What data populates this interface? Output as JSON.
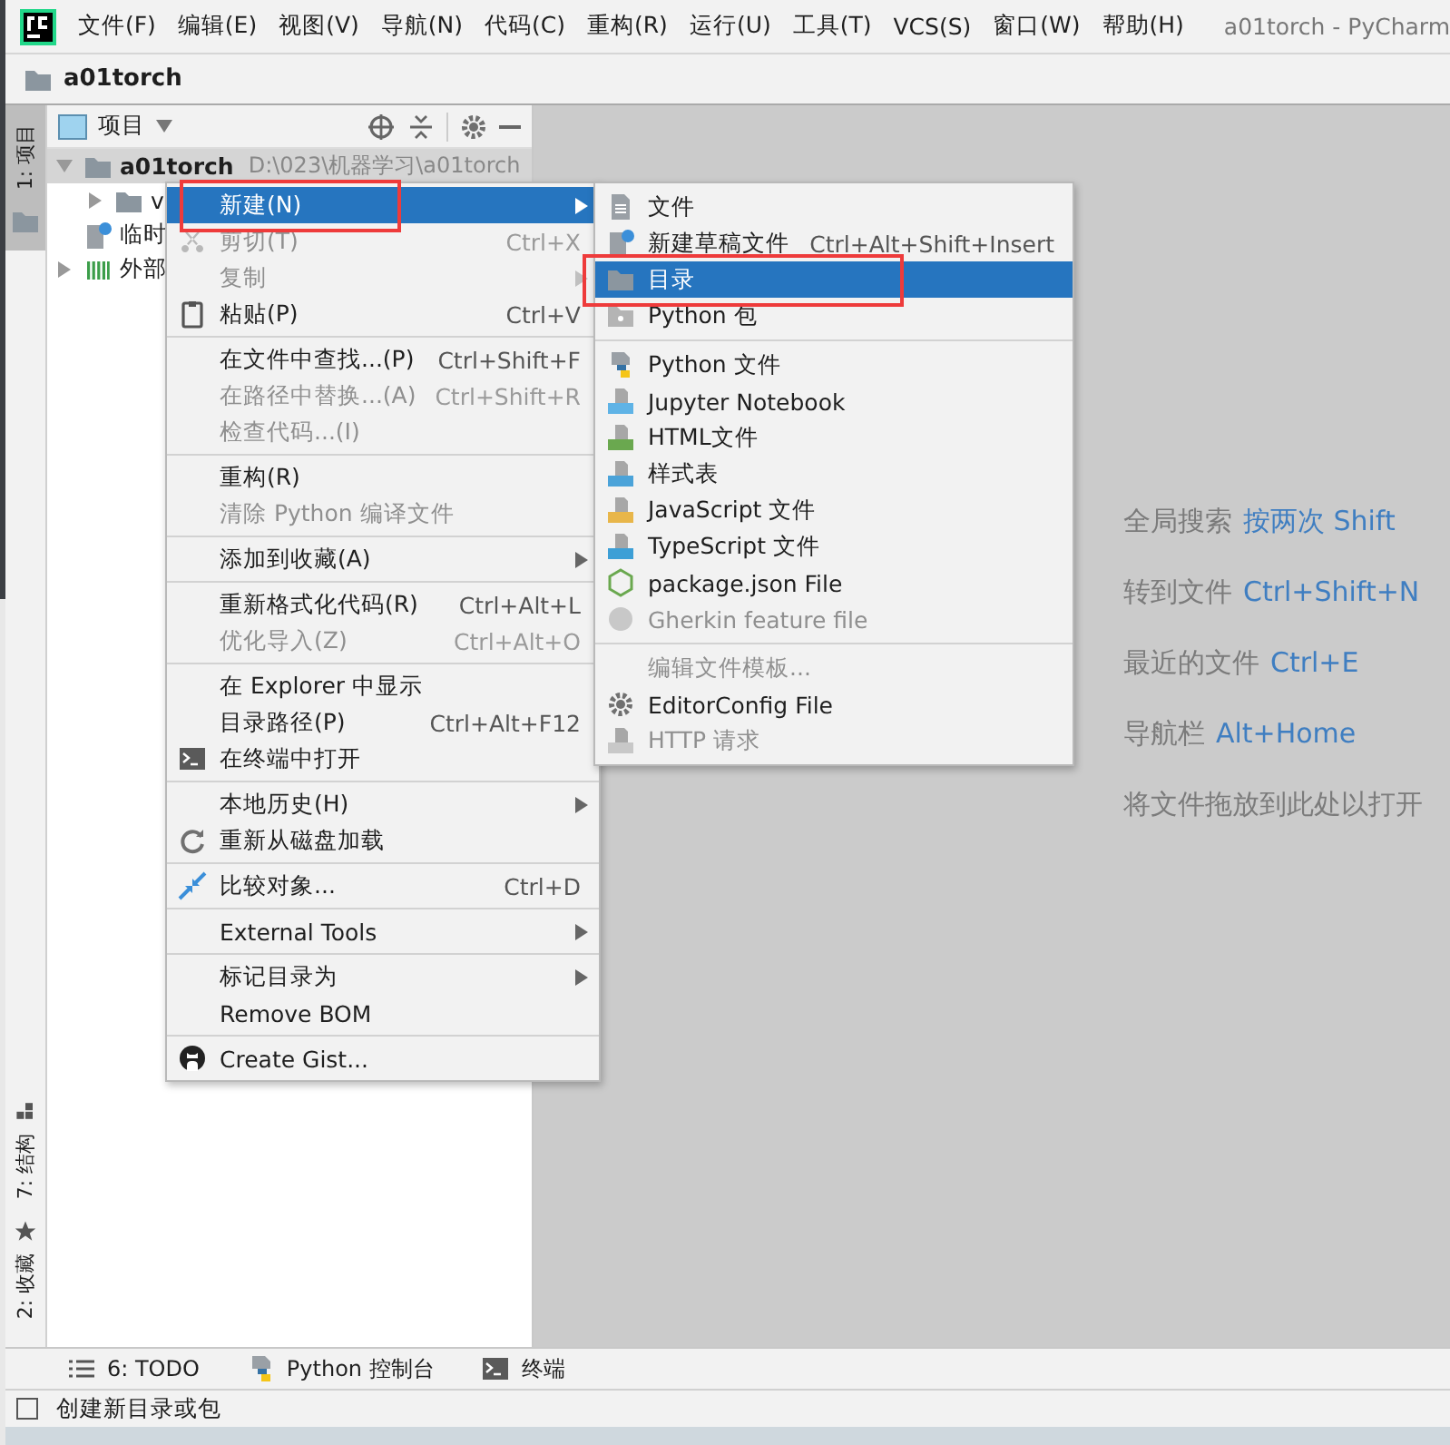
{
  "window": {
    "title": "a01torch - PyCharm"
  },
  "menu_bar": [
    "文件(F)",
    "编辑(E)",
    "视图(V)",
    "导航(N)",
    "代码(C)",
    "重构(R)",
    "运行(U)",
    "工具(T)",
    "VCS(S)",
    "窗口(W)",
    "帮助(H)"
  ],
  "nav_bar": {
    "crumb": "a01torch"
  },
  "tool_strip": [
    {
      "label": "1: 项目",
      "selected": true,
      "kind": "folder"
    },
    {
      "label": "7: 结构",
      "selected": false,
      "kind": "structure"
    },
    {
      "label": "2: 收藏",
      "selected": false,
      "kind": "star"
    }
  ],
  "project_panel": {
    "title": "项目",
    "tree": [
      {
        "label": "a01torch",
        "path": "D:\\023\\机器学习\\a01torch",
        "kind": "folder",
        "selected": true,
        "expanded": true,
        "children": [
          {
            "label": "v",
            "kind": "folder",
            "selected": false,
            "expanded": false
          }
        ]
      },
      {
        "label": "临时",
        "kind": "scratch",
        "selected": false
      },
      {
        "label": "外部",
        "kind": "library",
        "selected": false,
        "expanded": false
      }
    ]
  },
  "editor_hints": [
    {
      "label": "全局搜索",
      "shortcut": "按两次 Shift"
    },
    {
      "label": "转到文件",
      "shortcut": "Ctrl+Shift+N"
    },
    {
      "label": "最近的文件",
      "shortcut": "Ctrl+E"
    },
    {
      "label": "导航栏",
      "shortcut": "Alt+Home"
    },
    {
      "label": "将文件拖放到此处以打开"
    }
  ],
  "context_menu": {
    "groups": [
      {
        "items": [
          {
            "label": "新建(N)",
            "selected": true,
            "disabled": false,
            "submenu": true,
            "boxed": true
          },
          {
            "label": "剪切(T)",
            "shortcut": "Ctrl+X",
            "kind": "scissors",
            "selected": false,
            "disabled": true,
            "submenu": false,
            "boxed": false
          },
          {
            "label": "复制",
            "selected": false,
            "disabled": true,
            "submenu": true,
            "boxed": false
          },
          {
            "label": "粘贴(P)",
            "shortcut": "Ctrl+V",
            "kind": "clipboard",
            "selected": false,
            "disabled": false,
            "submenu": false,
            "boxed": false
          }
        ]
      },
      {
        "items": [
          {
            "label": "在文件中查找...(P)",
            "shortcut": "Ctrl+Shift+F",
            "selected": false,
            "disabled": false,
            "submenu": false,
            "boxed": false
          },
          {
            "label": "在路径中替换...(A)",
            "shortcut": "Ctrl+Shift+R",
            "selected": false,
            "disabled": true,
            "submenu": false,
            "boxed": false
          },
          {
            "label": "检查代码...(I)",
            "selected": false,
            "disabled": true,
            "submenu": false,
            "boxed": false
          }
        ]
      },
      {
        "items": [
          {
            "label": "重构(R)",
            "selected": false,
            "disabled": false,
            "submenu": false,
            "boxed": false
          },
          {
            "label": "清除 Python 编译文件",
            "selected": false,
            "disabled": true,
            "submenu": false,
            "boxed": false
          }
        ]
      },
      {
        "items": [
          {
            "label": "添加到收藏(A)",
            "selected": false,
            "disabled": false,
            "submenu": true,
            "boxed": false
          }
        ]
      },
      {
        "items": [
          {
            "label": "重新格式化代码(R)",
            "shortcut": "Ctrl+Alt+L",
            "selected": false,
            "disabled": false,
            "submenu": false,
            "boxed": false
          },
          {
            "label": "优化导入(Z)",
            "shortcut": "Ctrl+Alt+O",
            "selected": false,
            "disabled": true,
            "submenu": false,
            "boxed": false
          }
        ]
      },
      {
        "items": [
          {
            "label": "在 Explorer 中显示",
            "selected": false,
            "disabled": false,
            "submenu": false,
            "boxed": false
          },
          {
            "label": "目录路径(P)",
            "shortcut": "Ctrl+Alt+F12",
            "selected": false,
            "disabled": false,
            "submenu": false,
            "boxed": false
          },
          {
            "label": "在终端中打开",
            "kind": "terminal",
            "selected": false,
            "disabled": false,
            "submenu": false,
            "boxed": false
          }
        ]
      },
      {
        "items": [
          {
            "label": "本地历史(H)",
            "selected": false,
            "disabled": false,
            "submenu": true,
            "boxed": false
          },
          {
            "label": "重新从磁盘加载",
            "kind": "reload",
            "selected": false,
            "disabled": false,
            "submenu": false,
            "boxed": false
          }
        ]
      },
      {
        "items": [
          {
            "label": "比较对象...",
            "shortcut": "Ctrl+D",
            "kind": "compare",
            "selected": false,
            "disabled": false,
            "submenu": false,
            "boxed": false
          }
        ]
      },
      {
        "items": [
          {
            "label": "External Tools",
            "selected": false,
            "disabled": false,
            "submenu": true,
            "boxed": false
          }
        ]
      },
      {
        "items": [
          {
            "label": "标记目录为",
            "selected": false,
            "disabled": false,
            "submenu": true,
            "boxed": false
          },
          {
            "label": "Remove BOM",
            "selected": false,
            "disabled": false,
            "submenu": false,
            "boxed": false
          }
        ]
      },
      {
        "items": [
          {
            "label": "Create Gist...",
            "kind": "github",
            "selected": false,
            "disabled": false,
            "submenu": false,
            "boxed": false
          }
        ]
      }
    ]
  },
  "new_submenu": {
    "groups": [
      {
        "items": [
          {
            "label": "文件",
            "kind": "file",
            "selected": false,
            "disabled": false,
            "boxed": false
          },
          {
            "label": "新建草稿文件",
            "shortcut": "Ctrl+Alt+Shift+Insert",
            "kind": "scratch",
            "selected": false,
            "disabled": false,
            "boxed": false
          },
          {
            "label": "目录",
            "kind": "folder",
            "selected": true,
            "disabled": false,
            "boxed": true
          },
          {
            "label": "Python 包",
            "kind": "package",
            "selected": false,
            "disabled": false,
            "boxed": false
          }
        ]
      },
      {
        "items": [
          {
            "label": "Python 文件",
            "kind": "python",
            "selected": false,
            "disabled": false,
            "boxed": false
          },
          {
            "label": "Jupyter Notebook",
            "kind": "jupyter",
            "selected": false,
            "disabled": false,
            "boxed": false
          },
          {
            "label": "HTML文件",
            "kind": "html",
            "selected": false,
            "disabled": false,
            "boxed": false
          },
          {
            "label": "样式表",
            "kind": "css",
            "selected": false,
            "disabled": false,
            "boxed": false
          },
          {
            "label": "JavaScript 文件",
            "kind": "js",
            "selected": false,
            "disabled": false,
            "boxed": false
          },
          {
            "label": "TypeScript 文件",
            "kind": "ts",
            "selected": false,
            "disabled": false,
            "boxed": false
          },
          {
            "label": "package.json File",
            "kind": "json",
            "selected": false,
            "disabled": false,
            "boxed": false
          },
          {
            "label": "Gherkin feature file",
            "kind": "gherkin",
            "selected": false,
            "disabled": true,
            "boxed": false
          }
        ]
      },
      {
        "items": [
          {
            "label": "编辑文件模板...",
            "selected": false,
            "disabled": true,
            "boxed": false
          },
          {
            "label": "EditorConfig File",
            "kind": "gear",
            "selected": false,
            "disabled": false,
            "boxed": false
          },
          {
            "label": "HTTP 请求",
            "kind": "api",
            "selected": false,
            "disabled": true,
            "boxed": false
          }
        ]
      }
    ]
  },
  "bottom_tools": [
    {
      "label": "6: TODO",
      "kind": "list"
    },
    {
      "label": "Python 控制台",
      "kind": "python"
    },
    {
      "label": "终端",
      "kind": "terminal"
    }
  ],
  "status_bar": {
    "message": "创建新目录或包"
  }
}
